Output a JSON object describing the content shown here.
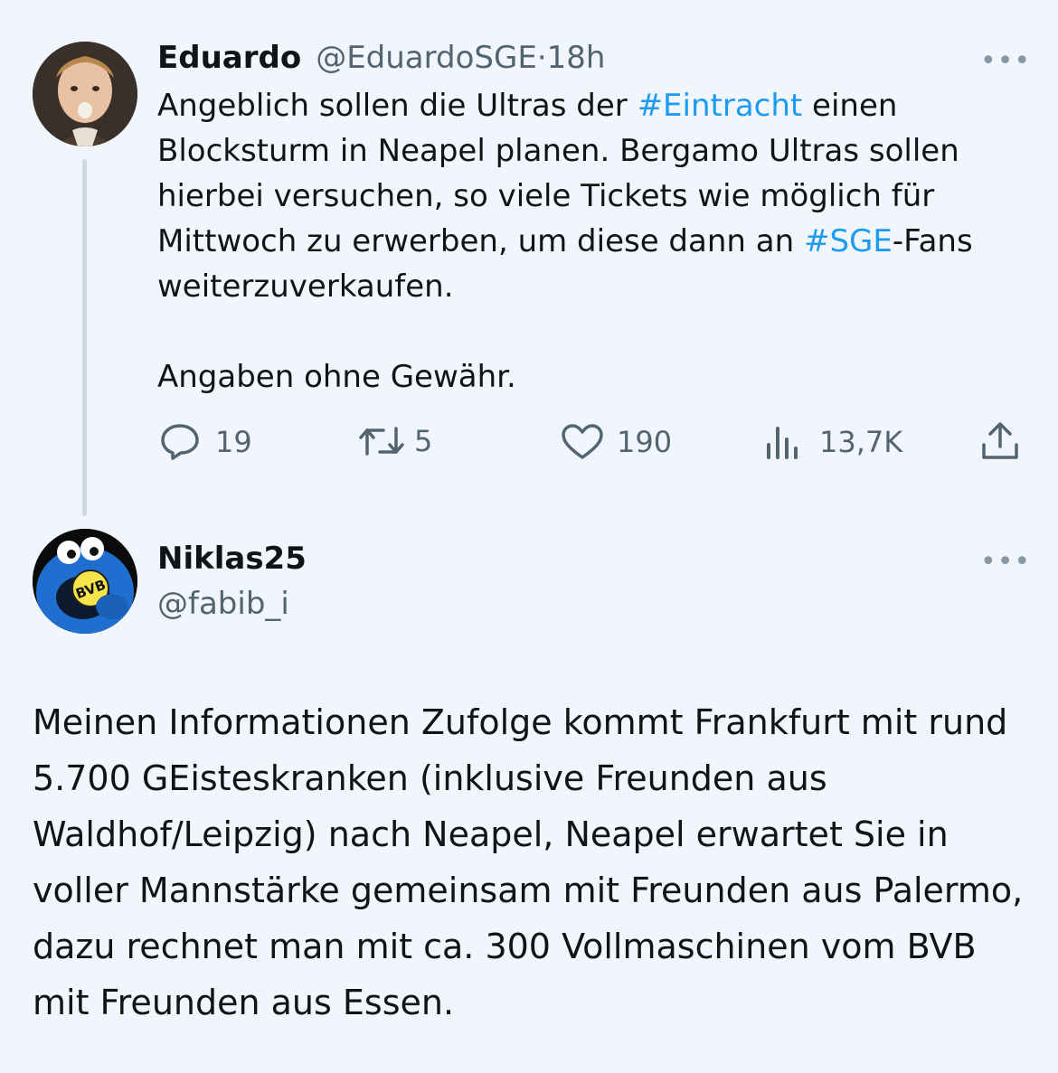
{
  "tweet": {
    "author_name": "Eduardo",
    "author_handle": "@EduardoSGE",
    "separator": " · ",
    "time": "18h",
    "more_label": "•••",
    "text": {
      "p1_a": "Angeblich sollen die Ultras der ",
      "hashtag1": "#Eintracht",
      "p1_b": " einen Blocksturm in Neapel planen. Bergamo Ultras sollen hierbei versuchen, so viele Tickets wie möglich für Mittwoch zu erwerben, um diese dann an ",
      "hashtag2": "#SGE",
      "p1_c": "-Fans weiterzuverkaufen.",
      "p2": "Angaben ohne Gewähr."
    },
    "actions": {
      "replies": "19",
      "retweets": "5",
      "likes": "190",
      "views": "13,7K"
    }
  },
  "reply": {
    "author_name": "Niklas25",
    "author_handle": "@fabib_i",
    "more_label": "•••",
    "text": "Meinen Informationen Zufolge kommt Frankfurt mit rund 5.700 GEisteskranken (inklusive Freunden aus Waldhof/Leipzig) nach Neapel, Neapel erwartet Sie in voller Mannstärke gemeinsam mit Freunden aus Palermo, dazu rechnet man mit ca. 300 Vollmaschinen vom BVB mit Freunden aus Essen.",
    "avatar_badge": "BVB"
  },
  "colors": {
    "background": "#f1f6fd",
    "text": "#0f1419",
    "secondary": "#536471",
    "hashtag": "#1d9bf0",
    "thread_line": "#cfd9e1"
  }
}
